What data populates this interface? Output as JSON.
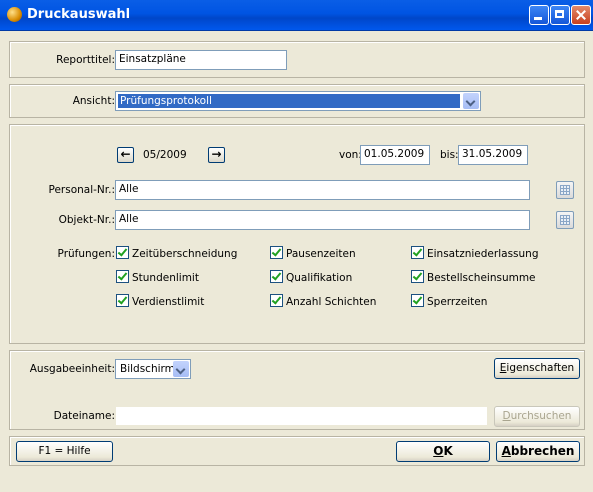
{
  "window": {
    "title": "Druckauswahl"
  },
  "report": {
    "label": "Reporttitel:",
    "value": "Einsatzpläne"
  },
  "view": {
    "label": "Ansicht:",
    "value": "Prüfungsprotokoll"
  },
  "period": {
    "month": "05/2009",
    "prev_arrow": "←",
    "next_arrow": "→",
    "from_label": "von:",
    "from_value": "01.05.2009",
    "to_label": "bis:",
    "to_value": "31.05.2009"
  },
  "personal": {
    "label": "Personal-Nr.:",
    "value": "Alle"
  },
  "object": {
    "label": "Objekt-Nr.:",
    "value": "Alle"
  },
  "checks": {
    "label": "Prüfungen:",
    "items": [
      "Zeitüberschneidung",
      "Pausenzeiten",
      "Einsatzniederlassung",
      "Stundenlimit",
      "Qualifikation",
      "Bestellscheinsumme",
      "Verdienstlimit",
      "Anzahl Schichten",
      "Sperrzeiten"
    ]
  },
  "output": {
    "label": "Ausgabeeinheit:",
    "value": "Bildschirm",
    "properties_first": "E",
    "properties_rest": "igenschaften"
  },
  "file": {
    "label": "Dateiname:",
    "value": "",
    "browse_first": "D",
    "browse_rest": "urchsuchen"
  },
  "buttons": {
    "help": "F1 = Hilfe",
    "ok_first": "O",
    "ok_rest": "K",
    "cancel_first": "A",
    "cancel_rest": "bbrechen"
  }
}
